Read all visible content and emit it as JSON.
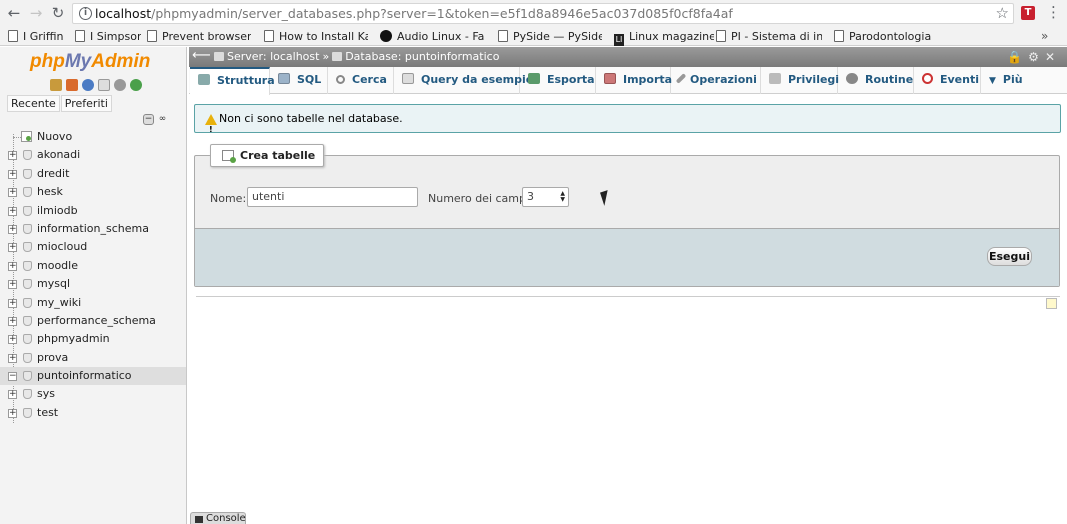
{
  "browser": {
    "url_host": "localhost",
    "url_rest": "/phpmyadmin/server_databases.php?server=1&token=e5f1d8a8946e5ac037d085f0cf8fa4af",
    "bookmarks": [
      {
        "label": "I Griffin",
        "icon": "page"
      },
      {
        "label": "I Simpson",
        "icon": "page"
      },
      {
        "label": "Prevent browser c",
        "icon": "page"
      },
      {
        "label": "How to Install Kart",
        "icon": "page"
      },
      {
        "label": "Audio Linux - Fare",
        "icon": "circle"
      },
      {
        "label": "PySide — PySide.C",
        "icon": "page"
      },
      {
        "label": "Linux magazine",
        "icon": "logo"
      },
      {
        "label": "PI - Sistema di inse",
        "icon": "page"
      },
      {
        "label": "Parodontologia",
        "icon": "page"
      }
    ],
    "bookmarks_more": "»"
  },
  "sidebar": {
    "logo_php": "php",
    "logo_my": "My",
    "logo_admin": "Admin",
    "link_recent": "Recente",
    "link_favorites": "Preferiti",
    "new_label": "Nuovo",
    "databases": [
      "akonadi",
      "dredit",
      "hesk",
      "ilmiodb",
      "information_schema",
      "miocloud",
      "moodle",
      "mysql",
      "my_wiki",
      "performance_schema",
      "phpmyadmin",
      "prova",
      "puntoinformatico",
      "sys",
      "test"
    ],
    "selected_database": "puntoinformatico"
  },
  "breadcrumb": {
    "server": "Server: localhost",
    "separator": "»",
    "database": "Database: puntoinformatico"
  },
  "tabs": {
    "structure": "Struttura",
    "sql": "SQL",
    "search": "Cerca",
    "query": "Query da esempio",
    "export": "Esporta",
    "import": "Importa",
    "operations": "Operazioni",
    "privileges": "Privilegi",
    "routines": "Routine",
    "events": "Eventi",
    "more": "Più"
  },
  "notice": {
    "text": "Non ci sono tabelle nel database."
  },
  "create_table": {
    "legend": "Crea tabelle",
    "name_label": "Nome:",
    "name_value": "utenti",
    "columns_label": "Numero dei campi:",
    "columns_value": "3",
    "go_button": "Esegui"
  },
  "console": {
    "label": "Console"
  },
  "colors": {
    "accent": "#235a81",
    "logo_orange": "#f18a00",
    "notice_border": "#5aa3a6"
  }
}
